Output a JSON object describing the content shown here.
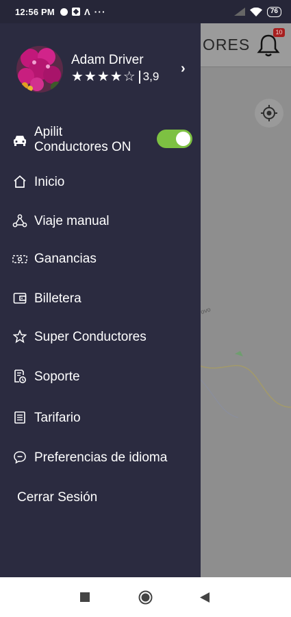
{
  "status_bar": {
    "time": "12:56 PM",
    "left_icons": [
      "pie-status-icon",
      "box-status-icon",
      "a-status-icon"
    ],
    "dots": "···",
    "battery": "76"
  },
  "background_app": {
    "title_partial": "ORES",
    "notification_count": "10",
    "map_label": "ovo"
  },
  "drawer": {
    "profile": {
      "name": "Adam Driver",
      "stars": "★★★★☆",
      "rating": "3,9",
      "chevron": "›"
    },
    "toggle_item": {
      "label_line1": "Apilit",
      "label_line2": "Conductores ON",
      "toggle_on": true,
      "toggle_color": "#7dc142"
    },
    "menu": [
      {
        "label": "Inicio",
        "icon": "home-icon"
      },
      {
        "label": "Viaje manual",
        "icon": "route-icon"
      },
      {
        "label": "Ganancias",
        "icon": "cash-icon"
      },
      {
        "label": "Billetera",
        "icon": "wallet-icon"
      },
      {
        "label": "Super Conductores",
        "icon": "star-icon"
      },
      {
        "label": "Soporte",
        "icon": "support-icon"
      },
      {
        "label": "Tarifario",
        "icon": "list-icon"
      },
      {
        "label": "Preferencias de idioma",
        "icon": "chat-icon"
      }
    ],
    "logout": "Cerrar Sesión"
  },
  "colors": {
    "drawer_bg": "#2b2b40",
    "toggle_on": "#7dc142",
    "badge": "#a71f1f"
  }
}
